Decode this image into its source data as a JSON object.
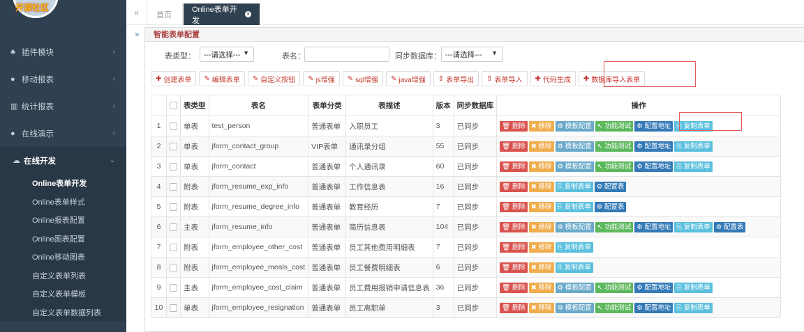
{
  "logo": {
    "text": "开源社区"
  },
  "sidebar": {
    "menu": [
      {
        "label": "插件模块",
        "icon": "puzzle-icon",
        "glyph": "♣"
      },
      {
        "label": "移动报表",
        "icon": "mobile-icon",
        "glyph": "●"
      },
      {
        "label": "统计报表",
        "icon": "bar-chart-icon",
        "glyph": "▥"
      },
      {
        "label": "在线演示",
        "icon": "globe-icon",
        "glyph": "●"
      }
    ],
    "active": {
      "label": "在线开发",
      "icon": "cloud-icon",
      "glyph": "☁"
    },
    "submenu": [
      "Online表单开发",
      "Online表单样式",
      "Online报表配置",
      "Online图表配置",
      "Online移动图表",
      "自定义表单列表",
      "自定义表单模板",
      "自定义表单数据列表"
    ]
  },
  "tabs": {
    "home": "首页",
    "current": "Online表单开发"
  },
  "panel": {
    "title": "智能表单配置"
  },
  "filters": {
    "table_type_label": "表类型：",
    "table_type_value": "---请选择---",
    "table_name_label": "表名：",
    "sync_label": "同步数据库：",
    "sync_value": "---请选择---"
  },
  "toolbar": {
    "create": "创建表单",
    "edit": "编辑表单",
    "custom_btn": "自定义按钮",
    "js": "js增强",
    "sql": "sql增强",
    "java": "java增强",
    "export": "表单导出",
    "import": "表单导入",
    "codegen": "代码生成",
    "db_import": "数据库导入表单"
  },
  "table": {
    "headers": [
      "",
      "表类型",
      "表名",
      "表单分类",
      "表描述",
      "版本",
      "同步数据库",
      "操作"
    ],
    "rows": [
      {
        "no": "1",
        "type": "单表",
        "name": "test_person",
        "category": "普通表单",
        "desc": "入职员工",
        "ver": "3",
        "sync": "已同步",
        "actions": [
          "删除",
          "移除",
          "模板配置",
          "功能测试",
          "配置地址",
          "复制表单"
        ]
      },
      {
        "no": "2",
        "type": "单表",
        "name": "jform_contact_group",
        "category": "VIP表单",
        "desc": "通讯录分组",
        "ver": "55",
        "sync": "已同步",
        "actions": [
          "删除",
          "移除",
          "模板配置",
          "功能测试",
          "配置地址",
          "复制表单"
        ]
      },
      {
        "no": "3",
        "type": "单表",
        "name": "jform_contact",
        "category": "普通表单",
        "desc": "个人通讯录",
        "ver": "60",
        "sync": "已同步",
        "actions": [
          "删除",
          "移除",
          "模板配置",
          "功能测试",
          "配置地址",
          "复制表单"
        ]
      },
      {
        "no": "4",
        "type": "附表",
        "name": "jform_resume_exp_info",
        "category": "普通表单",
        "desc": "工作信息表",
        "ver": "16",
        "sync": "已同步",
        "actions": [
          "删除",
          "移除",
          "复制表单",
          "配置表"
        ]
      },
      {
        "no": "5",
        "type": "附表",
        "name": "jform_resume_degree_info",
        "category": "普通表单",
        "desc": "教育经历",
        "ver": "7",
        "sync": "已同步",
        "actions": [
          "删除",
          "移除",
          "复制表单",
          "配置表"
        ]
      },
      {
        "no": "6",
        "type": "主表",
        "name": "jform_resume_info",
        "category": "普通表单",
        "desc": "简历信息表",
        "ver": "104",
        "sync": "已同步",
        "actions": [
          "删除",
          "移除",
          "模板配置",
          "功能测试",
          "配置地址",
          "复制表单",
          "配置表"
        ]
      },
      {
        "no": "7",
        "type": "附表",
        "name": "jform_employee_other_cost",
        "category": "普通表单",
        "desc": "员工其他费用明细表",
        "ver": "7",
        "sync": "已同步",
        "actions": [
          "删除",
          "移除",
          "复制表单"
        ]
      },
      {
        "no": "8",
        "type": "附表",
        "name": "jform_employee_meals_cost",
        "category": "普通表单",
        "desc": "员工餐费明细表",
        "ver": "6",
        "sync": "已同步",
        "actions": [
          "删除",
          "移除",
          "复制表单"
        ]
      },
      {
        "no": "9",
        "type": "主表",
        "name": "jform_employee_cost_claim",
        "category": "普通表单",
        "desc": "员工费用报销申请信息表",
        "ver": "36",
        "sync": "已同步",
        "actions": [
          "删除",
          "移除",
          "模板配置",
          "功能测试",
          "配置地址",
          "复制表单"
        ]
      },
      {
        "no": "10",
        "type": "单表",
        "name": "jform_employee_resignation",
        "category": "普通表单",
        "desc": "员工离职单",
        "ver": "3",
        "sync": "已同步",
        "actions": [
          "删除",
          "移除",
          "模板配置",
          "功能测试",
          "配置地址",
          "复制表单"
        ]
      }
    ]
  },
  "action_styles": {
    "删除": {
      "cls": "del",
      "glyph": "🗑",
      "icon": "trash-icon"
    },
    "移除": {
      "cls": "rm",
      "glyph": "✖",
      "icon": "x-icon"
    },
    "模板配置": {
      "cls": "tplg",
      "glyph": "⚙",
      "icon": "gear-icon"
    },
    "功能测试": {
      "cls": "test",
      "glyph": "↖",
      "icon": "pointer-icon"
    },
    "配置地址": {
      "cls": "cfg",
      "glyph": "⚙",
      "icon": "gear-icon"
    },
    "复制表单": {
      "cls": "copy",
      "glyph": "⎘",
      "icon": "copy-icon"
    },
    "配置表": {
      "cls": "table",
      "glyph": "⚙",
      "icon": "gear-icon"
    }
  }
}
